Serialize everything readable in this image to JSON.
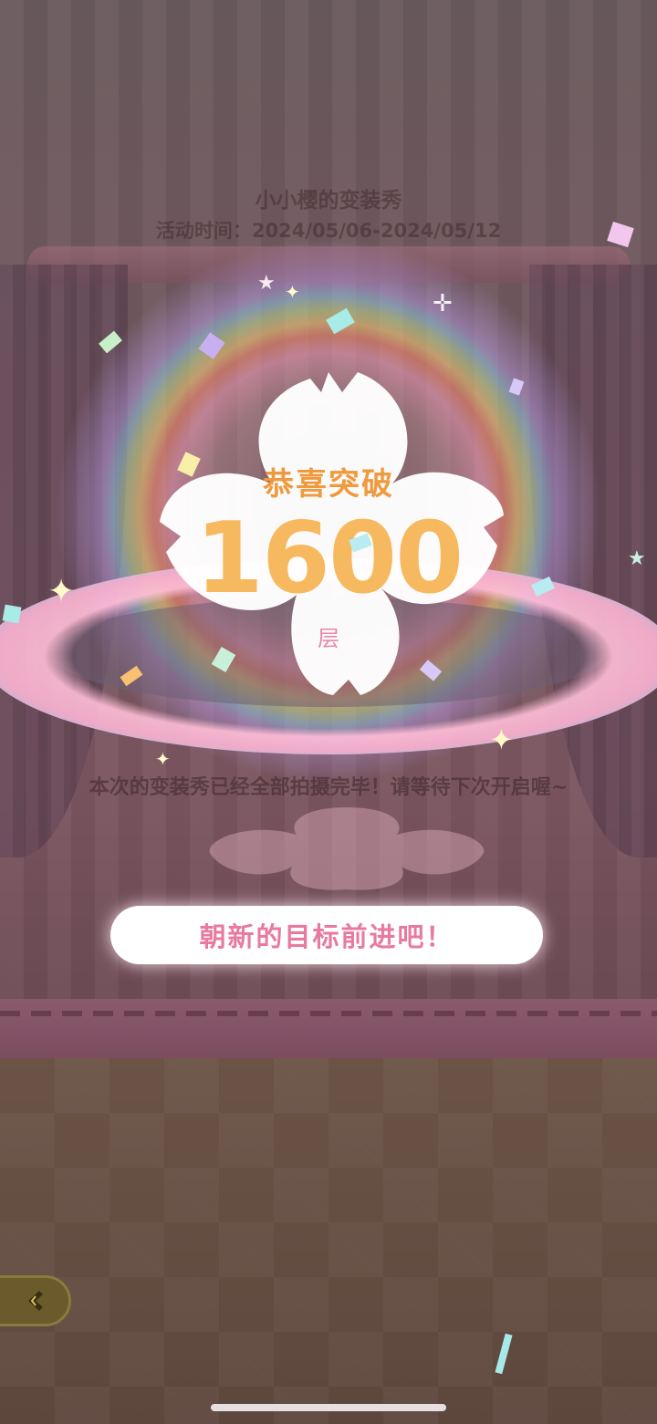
{
  "event": {
    "title": "小小樱的变装秀",
    "time": "活动时间：2024/05/06-2024/05/12"
  },
  "achievement": {
    "heading": "恭喜突破",
    "number": "1600",
    "unit": "层"
  },
  "message": "本次的变装秀已经全部拍摄完毕！请等待下次开启喔~",
  "cta_label": "朝新的目标前进吧！",
  "icons": {
    "back": "back-arrow-icon"
  },
  "colors": {
    "heading": "#ef9a3e",
    "number": "#f7b95f",
    "unit": "#e887a8",
    "cta_text": "#e87aa0",
    "flower": "#ffffff"
  }
}
